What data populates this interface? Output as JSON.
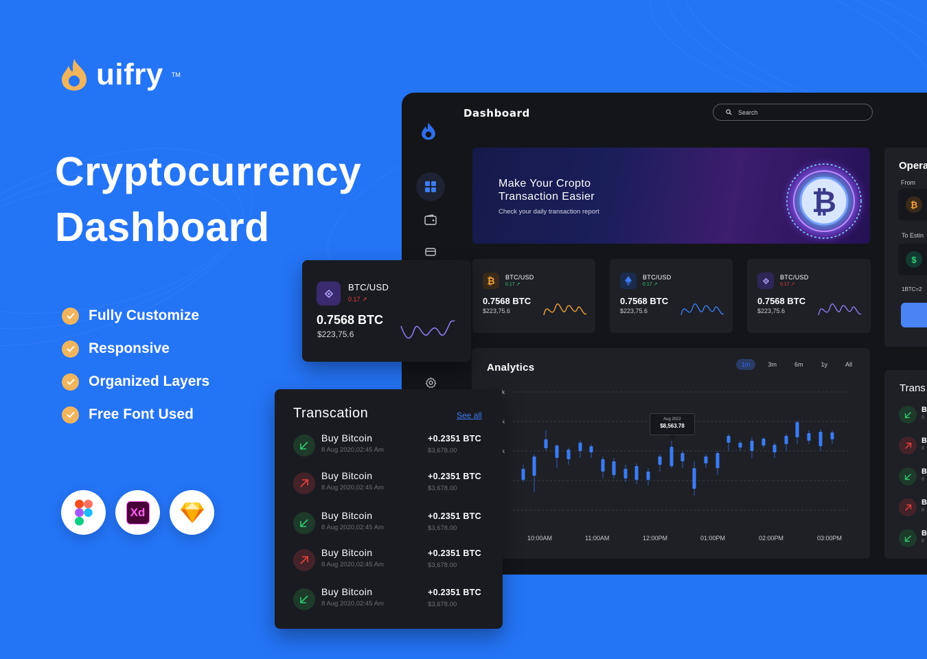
{
  "brand": {
    "name": "uifry",
    "tm": "TM"
  },
  "headline": {
    "line1": "Cryptocurrency",
    "line2": "Dashboard"
  },
  "features": [
    "Fully Customize",
    "Responsive",
    "Organized Layers",
    "Free Font Used"
  ],
  "apps": [
    {
      "name": "figma-icon"
    },
    {
      "name": "adobe-xd-icon",
      "label": "Xd"
    },
    {
      "name": "sketch-icon"
    }
  ],
  "dashboard": {
    "title": "Dashboard",
    "search": {
      "placeholder": "Search"
    },
    "banner": {
      "title": "Make Your Cropto Transaction Easier",
      "subtitle": "Check your daily transaction report"
    },
    "ticker_cards": [
      {
        "icon": "bitcoin-icon",
        "pair": "BTC/USD",
        "change": "0.17",
        "direction": "up",
        "amount": "0.7568 BTC",
        "usd": "$223,75.6",
        "color": "#f2a33a"
      },
      {
        "icon": "ethereum-icon",
        "pair": "BTC/USD",
        "change": "0.17",
        "direction": "up",
        "amount": "0.7568 BTC",
        "usd": "$223,75.6",
        "color": "#3b7cf4"
      },
      {
        "icon": "binance-icon",
        "pair": "BTC/USD",
        "change": "0.17",
        "direction": "down",
        "amount": "0.7568 BTC",
        "usd": "$223,75.6",
        "color": "#8a7cf0"
      }
    ],
    "analytics": {
      "title": "Analytics",
      "ranges": [
        "1m",
        "3m",
        "6m",
        "1y",
        "All"
      ],
      "active_range": "1m",
      "y_labels": [
        "k",
        "k",
        "k"
      ],
      "x_labels": [
        "10:00AM",
        "11:00AM",
        "12:00PM",
        "01:00PM",
        "02:00PM",
        "03:00PM"
      ],
      "tooltip": {
        "date": "Aug 2022",
        "value": "$8,563.78"
      }
    },
    "operation": {
      "title": "Opera",
      "from_label": "From",
      "to_label": "To Estin",
      "rate": "1BTC=2"
    },
    "right_transactions": {
      "title": "Trans",
      "rows": [
        "up",
        "down",
        "up",
        "down",
        "up"
      ],
      "label": "B",
      "sub": "8"
    }
  },
  "float_card": {
    "pair": "BTC/USD",
    "change": "0.17",
    "amount": "0.7568 BTC",
    "usd": "$223,75.6"
  },
  "transactions": {
    "title": "Transcation",
    "see_all": "See all",
    "rows": [
      {
        "name": "Buy Bitcoin",
        "date": "8 Aug 2020,02:45 Am",
        "btc": "+0.2351 BTC",
        "usd": "$3,678.00",
        "direction": "up"
      },
      {
        "name": "Buy Bitcoin",
        "date": "8 Aug 2020,02:45 Am",
        "btc": "+0.2351 BTC",
        "usd": "$3,678.00",
        "direction": "down"
      },
      {
        "name": "Buy Bitcoin",
        "date": "8 Aug 2020,02:45 Am",
        "btc": "+0.2351 BTC",
        "usd": "$3,678.00",
        "direction": "up"
      },
      {
        "name": "Buy Bitcoin",
        "date": "8 Aug 2020,02:45 Am",
        "btc": "+0.2351 BTC",
        "usd": "$3,678.00",
        "direction": "down"
      },
      {
        "name": "Buy Bitcoin",
        "date": "8 Aug 2020,02:45 Am",
        "btc": "+0.2351 BTC",
        "usd": "$3,678.00",
        "direction": "up"
      }
    ]
  },
  "colors": {
    "background": "#2474f6",
    "panel": "#141519",
    "card": "#1e2026",
    "accent": "#3b7cf4",
    "up": "#2ecc71",
    "down": "#e9413b",
    "brand_orange": "#f2b55d"
  }
}
